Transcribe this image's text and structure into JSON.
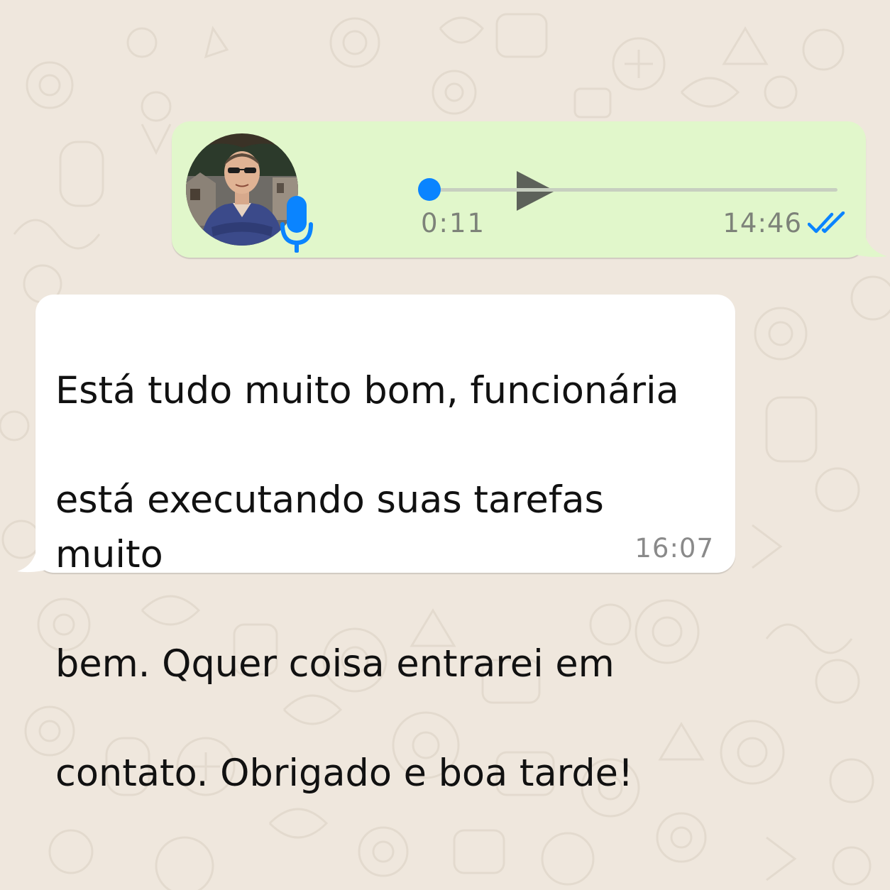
{
  "chat": {
    "wallpaper_icon": "doodle-pattern",
    "background_color": "#efe7dd"
  },
  "voice_message": {
    "direction": "outgoing",
    "bubble_color": "#e1f7cb",
    "avatar_icon": "contact-photo",
    "mic_icon": "microphone-icon",
    "play_icon": "play-icon",
    "duration": "0:11",
    "progress_fraction": 0.0,
    "time": "14:46",
    "status_icon": "double-check-icon",
    "status": "read",
    "accent_color": "#0a84ff"
  },
  "text_message": {
    "direction": "incoming",
    "bubble_color": "#ffffff",
    "lines": [
      "Está tudo muito bom, funcionária",
      "está executando suas tarefas muito",
      "bem. Qquer coisa entrarei em",
      "contato. Obrigado e boa tarde!"
    ],
    "time": "16:07"
  }
}
